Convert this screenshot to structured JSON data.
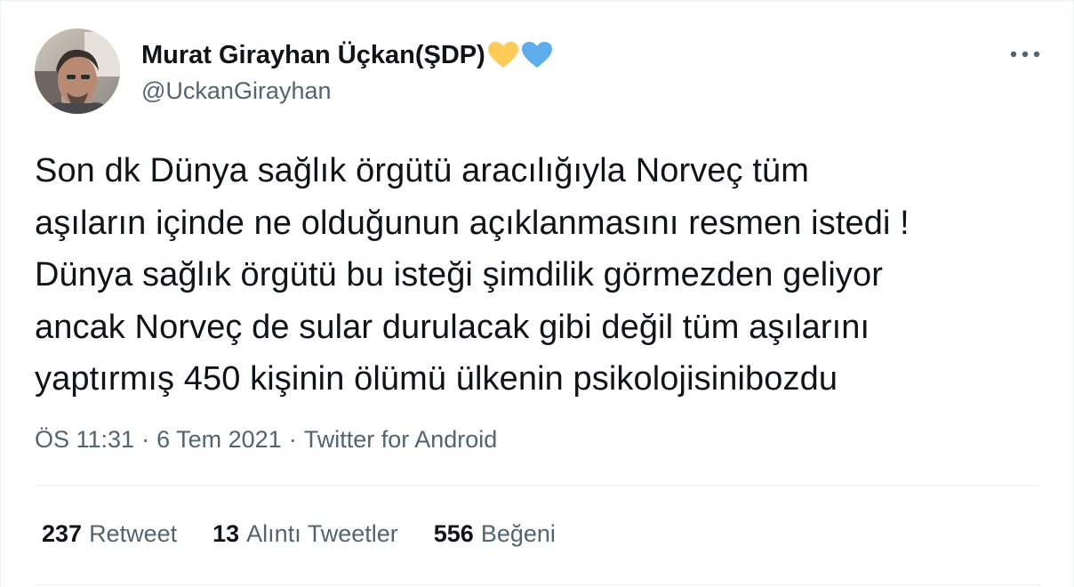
{
  "author": {
    "display_name": "Murat Girayhan Üçkan(ŞDP)",
    "name_emojis": [
      "yellow-heart-icon",
      "blue-heart-icon"
    ],
    "handle": "@UckanGirayhan"
  },
  "tweet": {
    "text": "Son dk Dünya sağlık örgütü aracılığıyla Norveç tüm\naşıların içinde ne olduğunun açıklanmasını resmen istedi !\nDünya sağlık örgütü bu isteği şimdilik görmezden geliyor\nancak Norveç de sular durulacak gibi değil tüm aşılarını\nyaptırmış 450 kişinin ölümü  ülkenin psikolojisinibozdu",
    "time": "ÖS 11:31",
    "date": "6 Tem 2021",
    "source": "Twitter for Android",
    "separator": "·"
  },
  "stats": [
    {
      "count": "237",
      "label": "Retweet"
    },
    {
      "count": "13",
      "label": "Alıntı Tweetler"
    },
    {
      "count": "556",
      "label": "Beğeni"
    }
  ],
  "icons": {
    "more": "more-options-icon"
  },
  "colors": {
    "primary_text": "#0f1419",
    "secondary_text": "#536471",
    "divider": "#eff3f4",
    "yellow_heart": "#fdcb58",
    "blue_heart": "#5dadec"
  }
}
